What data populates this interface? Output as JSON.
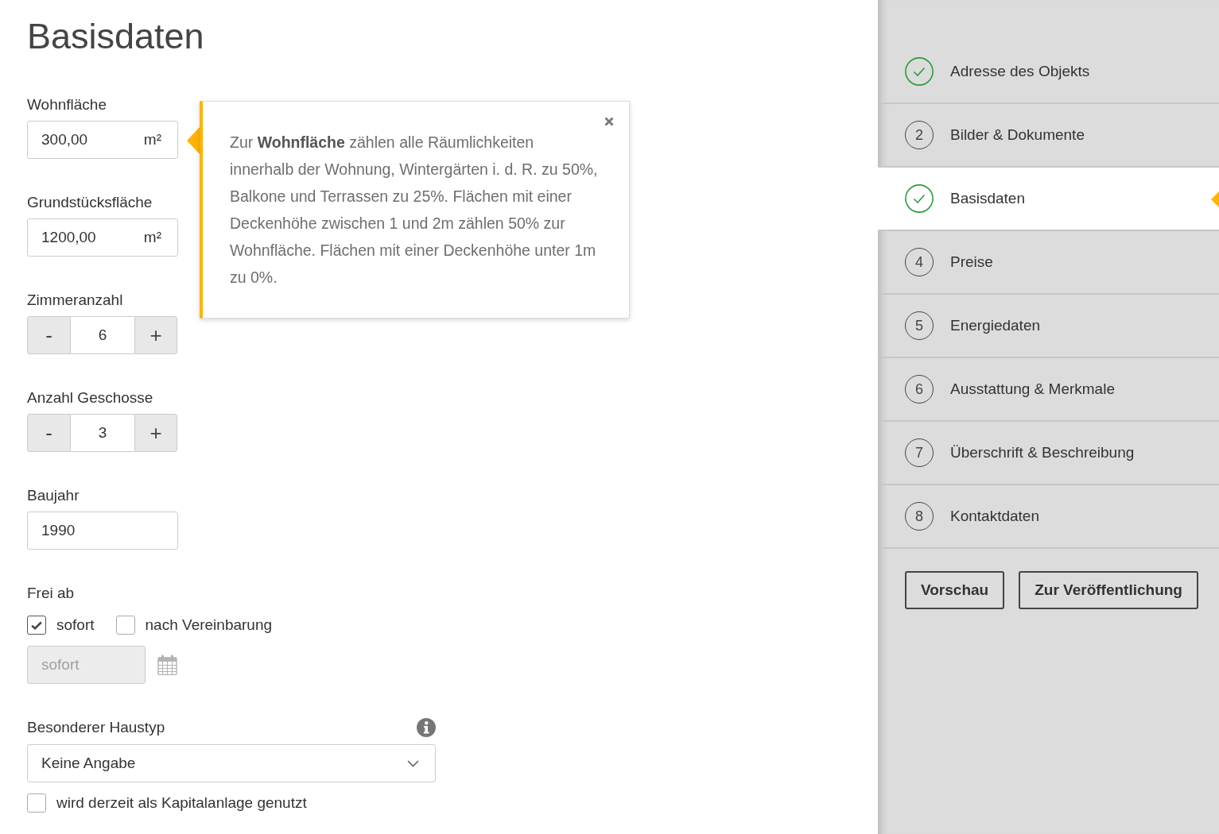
{
  "page_title": "Basisdaten",
  "fields": [
    {
      "kind": "unit_input",
      "label": "Wohnfläche",
      "value": "300,00",
      "unit": "m²"
    },
    {
      "kind": "unit_input",
      "label": "Grundstücksfläche",
      "value": "1200,00",
      "unit": "m²"
    },
    {
      "kind": "stepper",
      "label": "Zimmeranzahl",
      "value": "6",
      "decrement": "-",
      "increment": "+"
    },
    {
      "kind": "stepper",
      "label": "Anzahl Geschosse",
      "value": "3",
      "decrement": "-",
      "increment": "+"
    },
    {
      "kind": "text_input",
      "label": "Baujahr",
      "value": "1990"
    }
  ],
  "availability": {
    "label": "Frei ab",
    "options": [
      {
        "label": "sofort",
        "checked": true
      },
      {
        "label": "nach Vereinbarung",
        "checked": false
      }
    ],
    "date_field": {
      "value": "sofort",
      "disabled": true
    }
  },
  "house_type": {
    "label": "Besonderer Haustyp",
    "value": "Keine Angabe"
  },
  "investment_checkbox": {
    "label": "wird derzeit als Kapitalanlage genutzt",
    "checked": false
  },
  "tooltip": {
    "text": "Zur **Wohnfläche** zählen alle Räumlichkeiten innerhalb der Wohnung, Wintergärten i. d. R. zu 50%, Balkone und Terrassen zu 25%. Flächen mit einer Deckenhöhe zwischen 1 und 2m zählen 50% zur Wohnfläche. Flächen mit einer Deckenhöhe unter 1m zu 0%."
  },
  "steps": [
    {
      "label": "Adresse des Objekts",
      "done": true,
      "selected": false
    },
    {
      "number": "2",
      "label": "Bilder & Dokumente",
      "done": false,
      "selected": false
    },
    {
      "label": "Basisdaten",
      "done": true,
      "selected": true
    },
    {
      "number": "4",
      "label": "Preise",
      "done": false,
      "selected": false
    },
    {
      "number": "5",
      "label": "Energiedaten",
      "done": false,
      "selected": false
    },
    {
      "number": "6",
      "label": "Ausstattung & Merkmale",
      "done": false,
      "selected": false
    },
    {
      "number": "7",
      "label": "Überschrift & Beschreibung",
      "done": false,
      "selected": false
    },
    {
      "number": "8",
      "label": "Kontaktdaten",
      "done": false,
      "selected": false
    }
  ],
  "buttons": [
    "Vorschau",
    "Zur Veröffentlichung"
  ]
}
